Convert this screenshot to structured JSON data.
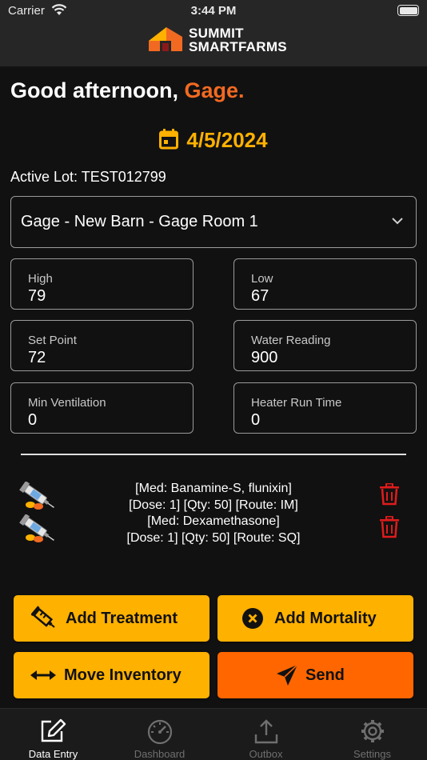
{
  "status_bar": {
    "carrier": "Carrier",
    "time": "3:44 PM"
  },
  "brand": {
    "line1": "SUMMIT",
    "line2": "SMARTFARMS"
  },
  "greeting": {
    "prefix": "Good afternoon, ",
    "name": "Gage."
  },
  "date": "4/5/2024",
  "active_lot": "Active Lot: TEST012799",
  "room_select": {
    "value": "Gage - New Barn - Gage Room 1"
  },
  "fields": {
    "high": {
      "label": "High",
      "value": "79"
    },
    "low": {
      "label": "Low",
      "value": "67"
    },
    "set_point": {
      "label": "Set Point",
      "value": "72"
    },
    "water_reading": {
      "label": "Water Reading",
      "value": "900"
    },
    "min_ventilation": {
      "label": "Min Ventilation",
      "value": "0"
    },
    "heater_run_time": {
      "label": "Heater Run Time",
      "value": "0"
    }
  },
  "treatments": [
    {
      "line1": "[Med: Banamine-S, flunixin]",
      "line2": "[Dose: 1]  [Qty: 50] [Route: IM]"
    },
    {
      "line1": "[Med: Dexamethasone]",
      "line2": "[Dose: 1]  [Qty: 50] [Route: SQ]"
    }
  ],
  "actions": {
    "add_treatment": "Add Treatment",
    "add_mortality": "Add Mortality",
    "move_inventory": "Move Inventory",
    "send": "Send"
  },
  "nav": {
    "data_entry": "Data Entry",
    "dashboard": "Dashboard",
    "outbox": "Outbox",
    "settings": "Settings",
    "active": "data_entry"
  },
  "colors": {
    "accent_orange": "#f26a21",
    "accent_yellow": "#ffb100",
    "send_orange": "#ff6600",
    "delete_red": "#e11b1b"
  },
  "icons": {
    "date": "calendar-icon",
    "room_select": "chevron-down-icon",
    "treatment": "syringe-pills-icon",
    "delete": "trash-icon",
    "add_treatment": "syringe-icon",
    "add_mortality": "x-circle-icon",
    "move_inventory": "arrows-horizontal-icon",
    "send": "paper-plane-icon"
  }
}
